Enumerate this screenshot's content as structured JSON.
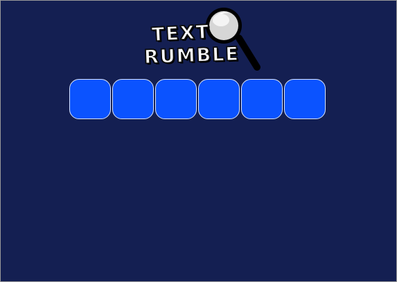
{
  "logo": {
    "line1": "TEXT",
    "line2": "RUMBLE",
    "icon": "magnifying-glass-icon"
  },
  "colors": {
    "background": "#141f52",
    "tile_fill": "#0b53ff",
    "tile_border": "#d9e4ff"
  },
  "tiles": [
    {
      "letter": ""
    },
    {
      "letter": ""
    },
    {
      "letter": ""
    },
    {
      "letter": ""
    },
    {
      "letter": ""
    },
    {
      "letter": ""
    }
  ]
}
